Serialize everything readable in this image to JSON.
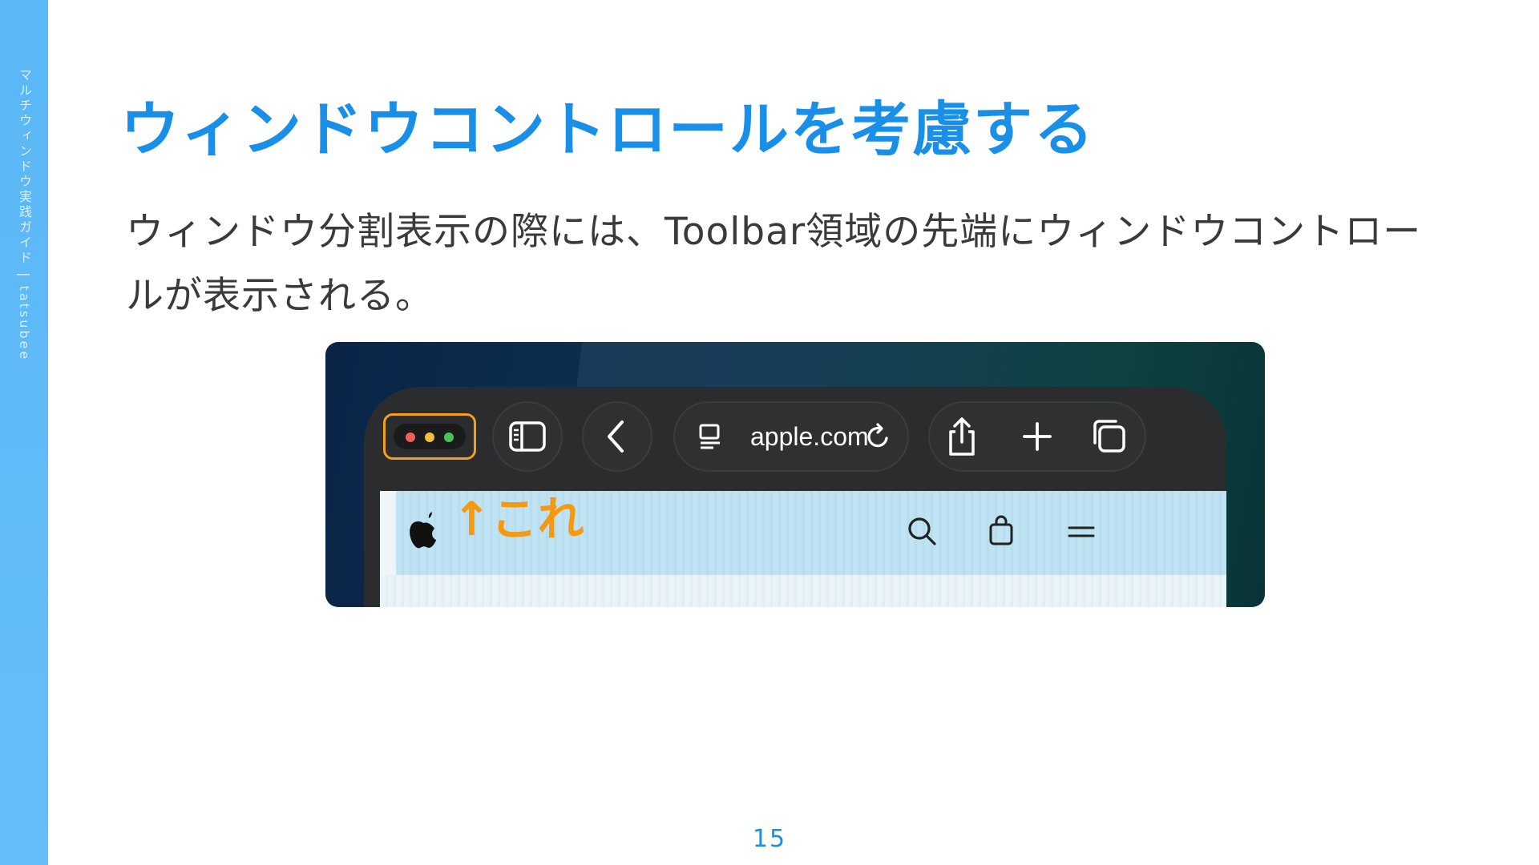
{
  "sidebar": {
    "label": "マルチウィンドウ実践ガイド | tatsubee",
    "color": "#5ab8f6"
  },
  "slide": {
    "title": "ウィンドウコントロールを考慮する",
    "body": "ウィンドウ分割表示の際には、Toolbar領域の先端にウィンドウコントロールが表示される。",
    "page_number": "15",
    "accent_color": "#1a8fe8"
  },
  "screenshot": {
    "url": "apple.com",
    "annotation": "↑これ",
    "annotation_color": "#f59a10",
    "toolbar_icons": [
      "window-controls-icon",
      "sidebar-icon",
      "back-chevron-icon",
      "page-icon",
      "reload-icon",
      "share-icon",
      "plus-icon",
      "tabs-icon"
    ],
    "site_icons": [
      "apple-logo-icon",
      "search-icon",
      "bag-icon",
      "menu-icon"
    ]
  }
}
